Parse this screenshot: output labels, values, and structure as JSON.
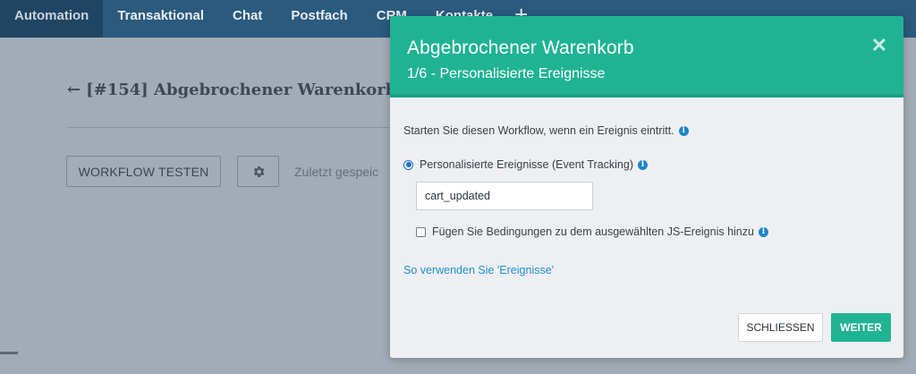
{
  "nav": {
    "items": [
      {
        "label": "Automation",
        "active": true
      },
      {
        "label": "Transaktional"
      },
      {
        "label": "Chat"
      },
      {
        "label": "Postfach"
      },
      {
        "label": "CRM"
      },
      {
        "label": "Kontakte"
      }
    ],
    "add_icon": "plus-icon"
  },
  "page": {
    "back_icon": "arrow-left-icon",
    "title": "[#154] Abgebrochener Warenkorb",
    "test_button": "WORKFLOW TESTEN",
    "settings_icon": "gear-icon",
    "status_text": "Zuletzt gespeic"
  },
  "modal": {
    "title": "Abgebrochener Warenkorb",
    "subtitle": "1/6 - Personalisierte Ereignisse",
    "close_icon": "close-icon",
    "intro": "Starten Sie diesen Workflow, wenn ein Ereignis eintritt.",
    "radio_label": "Personalisierte Ereignisse (Event Tracking)",
    "event_value": "cart_updated",
    "checkbox_label": "Fügen Sie Bedingungen zu dem ausgewählten JS-Ereignis hinzu",
    "help_link": "So verwenden Sie 'Ereignisse'",
    "close_button": "SCHLIESSEN",
    "next_button": "WEITER",
    "colors": {
      "accent": "#1fb394",
      "link": "#1f8fcb",
      "info": "#1c86c9"
    }
  }
}
